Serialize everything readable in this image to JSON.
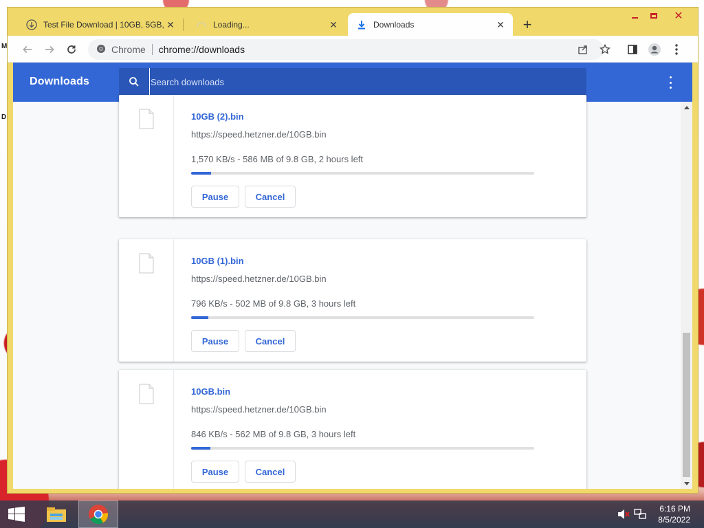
{
  "desktop": {
    "glyph_top": "M",
    "glyph_bottom": "D"
  },
  "browser": {
    "tabs": [
      {
        "title": "Test File Download | 10GB, 5GB, ",
        "icon": "download-circle-icon",
        "active": false
      },
      {
        "title": "Loading...",
        "icon": "loading-spinner-icon",
        "active": false
      },
      {
        "title": "Downloads",
        "icon": "download-arrow-icon",
        "active": true
      }
    ],
    "new_tab_label": "+",
    "omnibox": {
      "site_label": "Chrome",
      "url": "chrome://downloads"
    }
  },
  "downloads_page": {
    "title": "Downloads",
    "search_placeholder": "Search downloads",
    "items": [
      {
        "file_name": "10GB (2).bin",
        "url": "https://speed.hetzner.de/10GB.bin",
        "status": "1,570 KB/s - 586 MB of 9.8 GB, 2 hours left",
        "progress": 0.058,
        "pause_label": "Pause",
        "cancel_label": "Cancel"
      },
      {
        "file_name": "10GB (1).bin",
        "url": "https://speed.hetzner.de/10GB.bin",
        "status": "796 KB/s - 502 MB of 9.8 GB, 3 hours left",
        "progress": 0.05,
        "pause_label": "Pause",
        "cancel_label": "Cancel"
      },
      {
        "file_name": "10GB.bin",
        "url": "https://speed.hetzner.de/10GB.bin",
        "status": "846 KB/s - 562 MB of 9.8 GB, 3 hours left",
        "progress": 0.056,
        "pause_label": "Pause",
        "cancel_label": "Cancel"
      }
    ]
  },
  "taskbar": {
    "time": "6:16 PM",
    "date": "8/5/2022",
    "pinned": [
      "windows-start-icon",
      "file-explorer-icon",
      "chrome-icon"
    ]
  },
  "colors": {
    "accent": "#3367d6",
    "frame": "#f0d96a",
    "window_controls": "#c8202a"
  }
}
